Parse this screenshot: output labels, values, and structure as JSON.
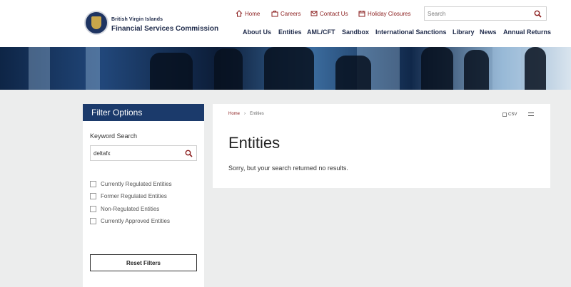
{
  "header": {
    "logo_line1": "British Virgin Islands",
    "logo_line2": "Financial Services Commission",
    "util_nav": [
      {
        "label": "Home",
        "icon": "home-icon"
      },
      {
        "label": "Careers",
        "icon": "briefcase-icon"
      },
      {
        "label": "Contact Us",
        "icon": "mail-icon"
      },
      {
        "label": "Holiday Closures",
        "icon": "calendar-icon"
      }
    ],
    "search": {
      "placeholder": "Search",
      "value": ""
    },
    "main_nav": [
      "About Us",
      "Entities",
      "AML/CFT",
      "Sandbox",
      "International Sanctions",
      "Library",
      "News",
      "Annual Returns"
    ]
  },
  "sidebar": {
    "title": "Filter Options",
    "keyword_label": "Keyword Search",
    "keyword_value": "deltafx",
    "filters": [
      {
        "label": "Currently Regulated Entities",
        "checked": false
      },
      {
        "label": "Former Regulated Entities",
        "checked": false
      },
      {
        "label": "Non-Regulated Entities",
        "checked": false
      },
      {
        "label": "Currently Approved Entities",
        "checked": false
      }
    ],
    "reset_label": "Reset Filters"
  },
  "content": {
    "breadcrumb": {
      "home": "Home",
      "separator": "›",
      "current": "Entities"
    },
    "csv_label": "CSV",
    "title": "Entities",
    "message": "Sorry, but your search returned no results."
  },
  "colors": {
    "navy": "#1b3a6b",
    "accent_red": "#8a1c1c",
    "page_bg": "#eceded"
  }
}
